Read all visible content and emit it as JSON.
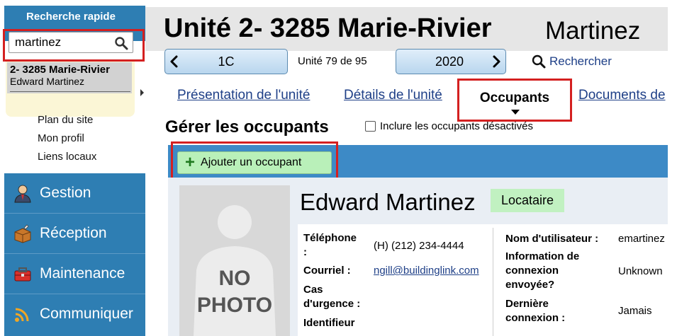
{
  "quick_search": {
    "title": "Recherche rapide",
    "query": "martinez",
    "result": {
      "line1": "2- 3285 Marie-Rivier",
      "line2": "Edward Martinez"
    }
  },
  "sidebar": {
    "links": [
      "Plan du site",
      "Mon profil",
      "Liens locaux"
    ],
    "nav": [
      {
        "label": "Gestion",
        "icon": "manager-icon"
      },
      {
        "label": "Réception",
        "icon": "package-icon"
      },
      {
        "label": "Maintenance",
        "icon": "toolbox-icon"
      },
      {
        "label": "Communiquer",
        "icon": "broadcast-icon"
      }
    ]
  },
  "header": {
    "unit_title": "Unité 2- 3285 Marie-Rivier",
    "unit_subtitle": "Martinez"
  },
  "unit_nav": {
    "unit_select": "1C",
    "position": "Unité 79 de 95",
    "year_select": "2020",
    "search_label": "Rechercher"
  },
  "tabs": [
    {
      "label": "Présentation de l'unité",
      "active": false
    },
    {
      "label": "Détails de l'unité",
      "active": false
    },
    {
      "label": "Occupants",
      "active": true
    },
    {
      "label": "Documents de",
      "active": false
    }
  ],
  "occupants": {
    "section_title": "Gérer les occupants",
    "include_inactive_label": "Inclure les occupants désactivés",
    "include_inactive_checked": false,
    "add_button_label": "Ajouter un occupant"
  },
  "occupant": {
    "photo_text_line1": "NO",
    "photo_text_line2": "PHOTO",
    "name": "Edward Martinez",
    "role": "Locataire",
    "fields_left": [
      {
        "label_line1": "Téléphone",
        "label_line2": ":",
        "value": "(H) (212) 234-4444"
      },
      {
        "label_line1": "Courriel :",
        "value": "ngill@buildinglink.com"
      },
      {
        "label_line1": "Cas",
        "label_line2": "d'urgence :",
        "value": ""
      },
      {
        "label_line1": "Identifieur",
        "value": ""
      }
    ],
    "fields_right": [
      {
        "label_line1": "Nom d'utilisateur :",
        "value": "emartinez"
      },
      {
        "label_line1": "Information de",
        "label_line2": "connexion",
        "label_line3": "envoyée?",
        "value": "Unknown"
      },
      {
        "label_line1": "Dernière",
        "label_line2": "connexion :",
        "value": "Jamais"
      }
    ]
  },
  "colors": {
    "sidebar_blue": "#2e7eb3",
    "highlight_red": "#d42020",
    "link_blue": "#1e3f87",
    "badge_green": "#c1f1c1",
    "button_green": "#b9f0b9"
  }
}
